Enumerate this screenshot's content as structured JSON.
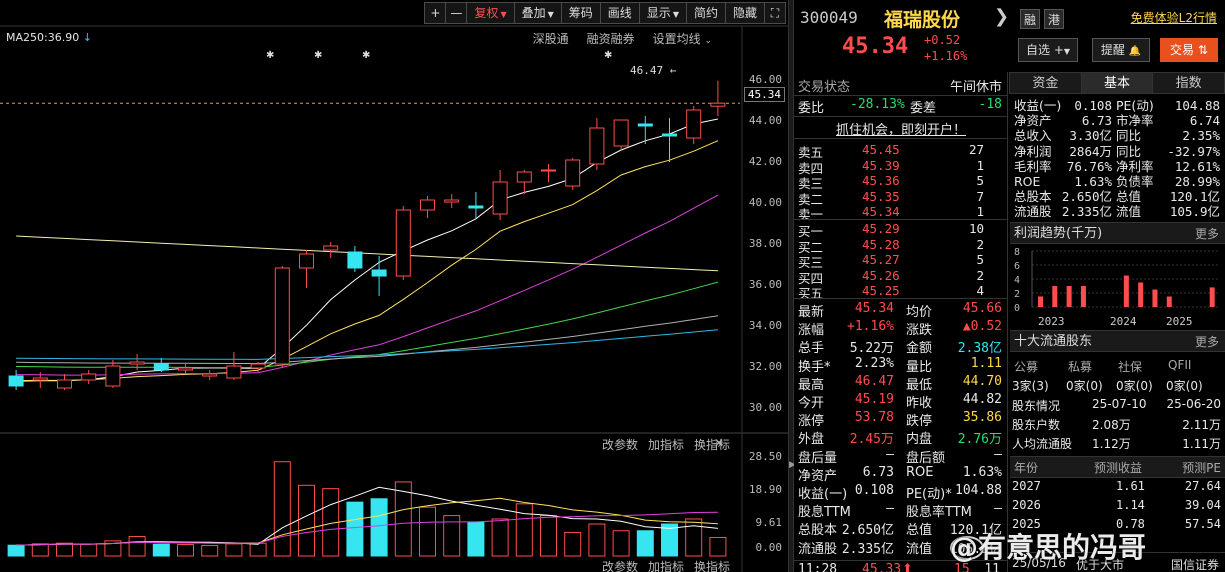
{
  "toolbar": {
    "plus": "+",
    "minus": "—",
    "adjust": "复权",
    "overlay": "叠加",
    "chips": "筹码",
    "draw": "画线",
    "display": "显示",
    "simple": "简约",
    "hide": "隐藏",
    "expand_icon": "expand-icon"
  },
  "ma_legend": "MA250:36.90",
  "chart_links": [
    "深股通",
    "融资融券",
    "设置均线"
  ],
  "price_axis": [
    "46.00",
    "44.00",
    "42.00",
    "40.00",
    "38.00",
    "36.00",
    "34.00",
    "32.00",
    "30.00"
  ],
  "current_price_tag": "45.34",
  "high_label": "46.47",
  "volume_axis": [
    "28.50",
    "18.90",
    "9.61",
    "0.00"
  ],
  "indicator_links": [
    "改参数",
    "加指标",
    "换指标"
  ],
  "chart_data": {
    "type": "candlestick",
    "ylim": [
      29,
      47.5
    ],
    "candles": [
      {
        "o": 31.7,
        "h": 32.0,
        "l": 31.0,
        "c": 31.2
      },
      {
        "o": 31.5,
        "h": 31.9,
        "l": 31.1,
        "c": 31.6
      },
      {
        "o": 31.1,
        "h": 31.8,
        "l": 31.0,
        "c": 31.5
      },
      {
        "o": 31.5,
        "h": 32.0,
        "l": 31.3,
        "c": 31.8
      },
      {
        "o": 31.2,
        "h": 32.5,
        "l": 31.1,
        "c": 32.2
      },
      {
        "o": 32.3,
        "h": 32.8,
        "l": 32.0,
        "c": 32.4
      },
      {
        "o": 32.3,
        "h": 32.6,
        "l": 31.9,
        "c": 32.0
      },
      {
        "o": 32.0,
        "h": 32.3,
        "l": 31.8,
        "c": 32.1
      },
      {
        "o": 31.7,
        "h": 32.0,
        "l": 31.5,
        "c": 31.8
      },
      {
        "o": 31.6,
        "h": 32.9,
        "l": 31.5,
        "c": 32.2
      },
      {
        "o": 32.1,
        "h": 32.4,
        "l": 31.9,
        "c": 32.3
      },
      {
        "o": 32.3,
        "h": 37.2,
        "l": 32.1,
        "c": 37.1
      },
      {
        "o": 37.1,
        "h": 38.0,
        "l": 36.1,
        "c": 37.8
      },
      {
        "o": 38.0,
        "h": 38.4,
        "l": 37.6,
        "c": 38.2
      },
      {
        "o": 37.9,
        "h": 38.2,
        "l": 36.9,
        "c": 37.1
      },
      {
        "o": 37.0,
        "h": 37.7,
        "l": 35.7,
        "c": 36.7
      },
      {
        "o": 36.7,
        "h": 40.2,
        "l": 36.5,
        "c": 40.0
      },
      {
        "o": 40.0,
        "h": 40.7,
        "l": 39.6,
        "c": 40.5
      },
      {
        "o": 40.4,
        "h": 40.8,
        "l": 40.1,
        "c": 40.5
      },
      {
        "o": 40.2,
        "h": 40.9,
        "l": 39.6,
        "c": 40.1
      },
      {
        "o": 39.8,
        "h": 42.0,
        "l": 39.5,
        "c": 41.4
      },
      {
        "o": 41.4,
        "h": 42.0,
        "l": 40.8,
        "c": 41.9
      },
      {
        "o": 42.0,
        "h": 42.3,
        "l": 41.4,
        "c": 42.0
      },
      {
        "o": 41.2,
        "h": 42.6,
        "l": 41.0,
        "c": 42.5
      },
      {
        "o": 42.3,
        "h": 44.6,
        "l": 42.0,
        "c": 44.1
      },
      {
        "o": 43.2,
        "h": 44.5,
        "l": 43.0,
        "c": 44.5
      },
      {
        "o": 44.3,
        "h": 44.7,
        "l": 43.3,
        "c": 44.2
      },
      {
        "o": 43.8,
        "h": 44.6,
        "l": 42.4,
        "c": 43.7
      },
      {
        "o": 43.6,
        "h": 45.2,
        "l": 43.3,
        "c": 45.0
      },
      {
        "o": 45.19,
        "h": 46.47,
        "l": 44.7,
        "c": 45.34
      }
    ],
    "volume": [
      3.2,
      3.6,
      3.8,
      3.5,
      4.5,
      5.8,
      3.5,
      3.4,
      3.1,
      3.6,
      3.8,
      28.0,
      21.0,
      20.0,
      16.0,
      17.0,
      22.0,
      14.5,
      12.0,
      10.0,
      11.0,
      15.5,
      12.0,
      7.0,
      9.5,
      7.5,
      7.5,
      9.5,
      11.0,
      5.5
    ],
    "volume_ylim": [
      0,
      30
    ]
  },
  "quote": {
    "code": "300049",
    "name": "福瑞股份",
    "tags": [
      "融",
      "港"
    ],
    "trial": "免费体验L2行情",
    "price": "45.34",
    "change": "+0.52",
    "change_pct": "+1.16%",
    "watchlist": "自选",
    "alert": "提醒",
    "trade": "交易",
    "status_label": "交易状态",
    "status_value": "午间休市",
    "wb_label": "委比",
    "wb_value": "-28.13%",
    "wc_label": "委差",
    "wc_value": "-18",
    "open_account": "抓住机会，即刻开户！",
    "sells": [
      {
        "label": "卖五",
        "price": "45.45",
        "vol": "27"
      },
      {
        "label": "卖四",
        "price": "45.39",
        "vol": "1"
      },
      {
        "label": "卖三",
        "price": "45.36",
        "vol": "5"
      },
      {
        "label": "卖二",
        "price": "45.35",
        "vol": "7"
      },
      {
        "label": "卖一",
        "price": "45.34",
        "vol": "1"
      }
    ],
    "buys": [
      {
        "label": "买一",
        "price": "45.29",
        "vol": "10"
      },
      {
        "label": "买二",
        "price": "45.28",
        "vol": "2"
      },
      {
        "label": "买三",
        "price": "45.27",
        "vol": "5"
      },
      {
        "label": "买四",
        "price": "45.26",
        "vol": "2"
      },
      {
        "label": "买五",
        "price": "45.25",
        "vol": "4"
      }
    ],
    "stats": [
      {
        "l1": "最新",
        "v1": "45.34",
        "c1": "red",
        "l2": "均价",
        "v2": "45.66",
        "c2": "red"
      },
      {
        "l1": "涨幅",
        "v1": "+1.16%",
        "c1": "red",
        "l2": "涨跌",
        "v2": "▲0.52",
        "c2": "red"
      },
      {
        "l1": "总手",
        "v1": "5.22万",
        "c1": "white",
        "l2": "金额",
        "v2": "2.38亿",
        "c2": "cyan"
      },
      {
        "l1": "换手*",
        "v1": "2.23%",
        "c1": "white",
        "l2": "量比",
        "v2": "1.11",
        "c2": "yellow"
      },
      {
        "l1": "最高",
        "v1": "46.47",
        "c1": "red",
        "l2": "最低",
        "v2": "44.70",
        "c2": "yellow"
      },
      {
        "l1": "今开",
        "v1": "45.19",
        "c1": "red",
        "l2": "昨收",
        "v2": "44.82",
        "c2": "white"
      },
      {
        "l1": "涨停",
        "v1": "53.78",
        "c1": "red",
        "l2": "跌停",
        "v2": "35.86",
        "c2": "yellow"
      },
      {
        "l1": "外盘",
        "v1": "2.45万",
        "c1": "red",
        "l2": "内盘",
        "v2": "2.76万",
        "c2": "green"
      },
      {
        "l1": "盘后量",
        "v1": "—",
        "c1": "white",
        "l2": "盘后额",
        "v2": "—",
        "c2": "white"
      },
      {
        "l1": "净资产",
        "v1": "6.73",
        "c1": "white",
        "l2": "ROE",
        "v2": "1.63%",
        "c2": "white"
      },
      {
        "l1": "收益(一)",
        "v1": "0.108",
        "c1": "white",
        "l2": "PE(动)*",
        "v2": "104.88",
        "c2": "white"
      },
      {
        "l1": "股息TTM",
        "v1": "—",
        "c1": "white",
        "l2": "股息率TTM",
        "v2": "—",
        "c2": "white"
      },
      {
        "l1": "总股本",
        "v1": "2.650亿",
        "c1": "white",
        "l2": "总值",
        "v2": "120.1亿",
        "c2": "white"
      },
      {
        "l1": "流通股",
        "v1": "2.335亿",
        "c1": "white",
        "l2": "流值",
        "v2": "105.9亿",
        "c2": "white"
      }
    ],
    "last_trade": {
      "time": "11:28",
      "price": "45.33",
      "vol": "15",
      "count": "11"
    }
  },
  "right": {
    "tabs": [
      "资金",
      "基本",
      "指数"
    ],
    "fundamentals": [
      {
        "l1": "收益(一)",
        "v1": "0.108",
        "l2": "PE(动)",
        "v2": "104.88"
      },
      {
        "l1": "净资产",
        "v1": "6.73",
        "l2": "市净率",
        "v2": "6.74"
      },
      {
        "l1": "总收入",
        "v1": "3.30亿",
        "l2": "同比",
        "v2": "2.35%"
      },
      {
        "l1": "净利润",
        "v1": "2864万",
        "l2": "同比",
        "v2": "-32.97%"
      },
      {
        "l1": "毛利率",
        "v1": "76.76%",
        "l2": "净利率",
        "v2": "12.61%"
      },
      {
        "l1": "ROE",
        "v1": "1.63%",
        "l2": "负债率",
        "v2": "28.99%"
      },
      {
        "l1": "总股本",
        "v1": "2.650亿",
        "l2": "总值",
        "v2": "120.1亿"
      },
      {
        "l1": "流通股",
        "v1": "2.335亿",
        "l2": "流值",
        "v2": "105.9亿"
      }
    ],
    "profit_title": "利润趋势(千万)",
    "more": "更多",
    "profit_chart": {
      "type": "bar",
      "y_ticks": [
        "8",
        "6",
        "4",
        "2",
        "0"
      ],
      "ylim": [
        0,
        8
      ],
      "x_labels": [
        "2023",
        "2024",
        "2025"
      ],
      "values": [
        1.5,
        3.0,
        3.0,
        3.0,
        0,
        0,
        4.5,
        3.5,
        2.5,
        1.5,
        0,
        0,
        2.8
      ]
    },
    "holders_title": "十大流通股东",
    "holder_types": [
      "公募",
      "私募",
      "社保",
      "QFII"
    ],
    "holder_counts": [
      "3家(3)",
      "0家(0)",
      "0家(0)",
      "0家(0)"
    ],
    "holder_rows": [
      {
        "label": "股东情况",
        "a": "25-07-10",
        "b": "25-06-20"
      },
      {
        "label": "股东户数",
        "a": "2.08万",
        "b": "2.11万"
      },
      {
        "label": "人均流通股",
        "a": "1.12万",
        "b": "1.11万"
      }
    ],
    "forecast_head": [
      "年份",
      "预测收益",
      "预测PE"
    ],
    "forecast": [
      {
        "year": "2027",
        "eps": "1.61",
        "pe": "27.64"
      },
      {
        "year": "2026",
        "eps": "1.14",
        "pe": "39.04"
      },
      {
        "year": "2025",
        "eps": "0.78",
        "pe": "57.54"
      }
    ],
    "bottom_date": "25/05/16",
    "bottom_text": "优于大市",
    "bottom_broker": "国信证券"
  },
  "watermark": "@有意思的冯哥"
}
